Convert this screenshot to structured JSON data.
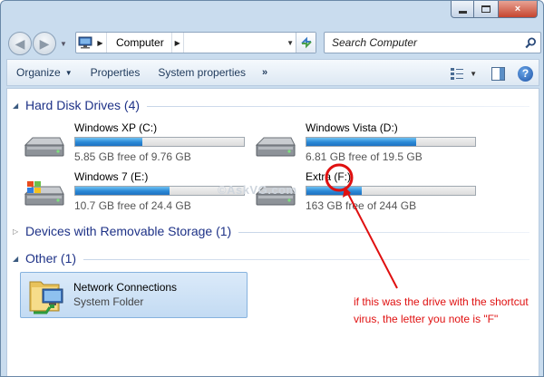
{
  "window": {
    "caption_close": "×"
  },
  "nav": {
    "address_location": "Computer",
    "search_placeholder": "Search Computer"
  },
  "toolbar": {
    "organize": "Organize",
    "properties": "Properties",
    "system_properties": "System properties",
    "more": "»"
  },
  "groups": {
    "hard_disks": "Hard Disk Drives (4)",
    "removable": "Devices with Removable Storage (1)",
    "other": "Other (1)"
  },
  "drives": [
    {
      "name": "Windows XP (C:)",
      "free": "5.85 GB free of 9.76 GB",
      "used_fraction": 0.4,
      "icon": "hard-drive-icon"
    },
    {
      "name": "Windows Vista (D:)",
      "free": "6.81 GB free of 19.5 GB",
      "used_fraction": 0.65,
      "icon": "hard-drive-icon"
    },
    {
      "name": "Windows 7 (E:)",
      "free": "10.7 GB free of 24.4 GB",
      "used_fraction": 0.56,
      "icon": "windows-drive-icon"
    },
    {
      "name": "Extra (F:)",
      "free": "163 GB free of 244 GB",
      "used_fraction": 0.33,
      "icon": "hard-drive-icon"
    }
  ],
  "other_items": [
    {
      "name": "Network Connections",
      "type": "System Folder",
      "icon": "network-folder-icon"
    }
  ],
  "watermark": "©AskVG.com",
  "annotation": "if this was the drive with the shortcut virus, the letter you note is \"F\"",
  "colors": {
    "group_title": "#1e3287",
    "capacity_bar": "#2a88d6",
    "annotation": "#e01010",
    "selection": "#c3dbf3"
  }
}
